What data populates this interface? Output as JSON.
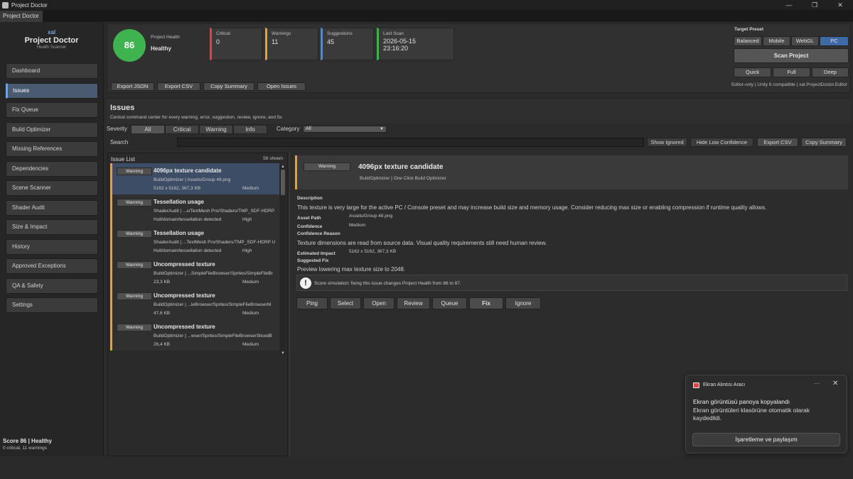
{
  "window": {
    "title": "Project Doctor",
    "tab": "Project Doctor",
    "controls": [
      "—",
      "❐",
      "✕"
    ]
  },
  "sidebar": {
    "brand_small": "xal",
    "brand_name": "Project Doctor",
    "brand_sub": "Health Scanner",
    "items": [
      {
        "label": "Dashboard"
      },
      {
        "label": "Issues"
      },
      {
        "label": "Fix Queue"
      },
      {
        "label": "Build Optimizer"
      },
      {
        "label": "Missing References"
      },
      {
        "label": "Dependencies"
      },
      {
        "label": "Scene Scanner"
      },
      {
        "label": "Shader Audit"
      },
      {
        "label": "Size & Impact"
      },
      {
        "label": "History"
      },
      {
        "label": "Approved Exceptions"
      },
      {
        "label": "QA & Safety"
      },
      {
        "label": "Settings"
      }
    ],
    "active_item": "Issues",
    "footer_score": "Score 86 | Healthy",
    "footer_detail": "0 critical, 11 warnings"
  },
  "header": {
    "score": "86",
    "health_label": "Project Health",
    "health_value": "Healthy",
    "stats": {
      "critical": {
        "label": "Critical",
        "value": "0"
      },
      "warnings": {
        "label": "Warnings",
        "value": "11"
      },
      "suggestions": {
        "label": "Suggestions",
        "value": "45"
      },
      "last_scan": {
        "label": "Last Scan",
        "date": "2026-05-15",
        "time": "23:16:20"
      }
    },
    "buttons": {
      "export_json": "Export JSON",
      "export_csv": "Export CSV",
      "copy_summary": "Copy Summary",
      "open_issues": "Open Issues"
    },
    "target_preset_label": "Target Preset",
    "presets": {
      "balanced": "Balanced",
      "mobile": "Mobile",
      "webgl": "WebGL",
      "pc": "PC"
    },
    "selected_preset": "PC",
    "scan_button": "Scan Project",
    "modes": {
      "quick": "Quick",
      "full": "Full",
      "deep": "Deep"
    },
    "compat": "Editor-only | Unity 6 compatible | xal.ProjectDoctor.Editor"
  },
  "issues_page": {
    "title": "Issues",
    "description": "Central command center for every warning, error, suggestion, review, ignore, and fix.",
    "severity_label": "Severity",
    "severity_options": {
      "all": "All",
      "critical": "Critical",
      "warning": "Warning",
      "info": "Info"
    },
    "category_label": "Category",
    "category_value": "All",
    "search_label": "Search",
    "search_value": "",
    "show_ignored": "Show Ignored",
    "hide_low_confidence": "Hide Low Confidence",
    "export_csv": "Export CSV",
    "copy_summary": "Copy Summary"
  },
  "issue_list": {
    "title": "Issue List",
    "count": "56 shown",
    "items": [
      {
        "badge": "Warning",
        "title": "4096px texture candidate",
        "source": "BuildOptimizer | Assets/Group 48.png",
        "meta": "5162 x 5162, 367,3 KB",
        "confidence": "Medium"
      },
      {
        "badge": "Warning",
        "title": "Tessellation usage",
        "source": "ShaderAudit | ...s/TextMesh Pro/Shaders/TMP_SDF-HDRP",
        "meta": "Hull/domain/tessellation detected",
        "confidence": "High"
      },
      {
        "badge": "Warning",
        "title": "Tessellation usage",
        "source": "ShaderAudit | ...TextMesh Pro/Shaders/TMP_SDF-HDRP U",
        "meta": "Hull/domain/tessellation detected",
        "confidence": "High"
      },
      {
        "badge": "Warning",
        "title": "Uncompressed texture",
        "source": "BuildOptimizer | ...SimpleFileBrowser/Sprites/SimpleFileBr",
        "meta": "23,3 KB",
        "confidence": "Medium"
      },
      {
        "badge": "Warning",
        "title": "Uncompressed texture",
        "source": "BuildOptimizer | ...leBrowser/Sprites/SimpleFileBrowserM",
        "meta": "47,6 KB",
        "confidence": "Medium"
      },
      {
        "badge": "Warning",
        "title": "Uncompressed texture",
        "source": "BuildOptimizer | ...wser/Sprites/SimpleFileBrowserSlicedB",
        "meta": "26,4 KB",
        "confidence": "Medium"
      }
    ]
  },
  "detail": {
    "badge": "Warning",
    "title": "4096px texture candidate",
    "source": "BuildOptimizer | One Click Build Optimizer",
    "description_label": "Description",
    "description": "This texture is very large for the active PC / Console preset and may increase build size and memory usage. Consider reducing max size or enabling compression if runtime quality allows.",
    "asset_path_label": "Asset Path",
    "asset_path": "Assets/Group 48.png",
    "confidence_label": "Confidence",
    "confidence": "Medium",
    "confidence_reason_label": "Confidence Reason",
    "confidence_reason": "Texture dimensions are read from source data. Visual quality requirements still need human review.",
    "estimated_impact_label": "Estimated Impact",
    "estimated_impact": "5162 x 5162, 367,3 KB",
    "suggested_fix_label": "Suggested Fix",
    "suggested_fix": "Preview lowering max texture size to 2048.",
    "simulation_icon": "!",
    "simulation": "Score simulation: fixing this issue changes Project Health from 86 to 87.",
    "actions": {
      "ping": "Ping",
      "select": "Select",
      "open": "Open",
      "review": "Review",
      "queue": "Queue",
      "fix": "Fix",
      "ignore": "Ignore"
    }
  },
  "toast": {
    "app": "Ekran Alıntısı Aracı",
    "heading": "Ekran görüntüsü panoya kopyalandı",
    "body": "Ekran görüntüleri klasörüne otomatik olarak kaydedildi.",
    "button": "İşaretleme ve paylaşım",
    "more": "···",
    "close": "✕"
  }
}
